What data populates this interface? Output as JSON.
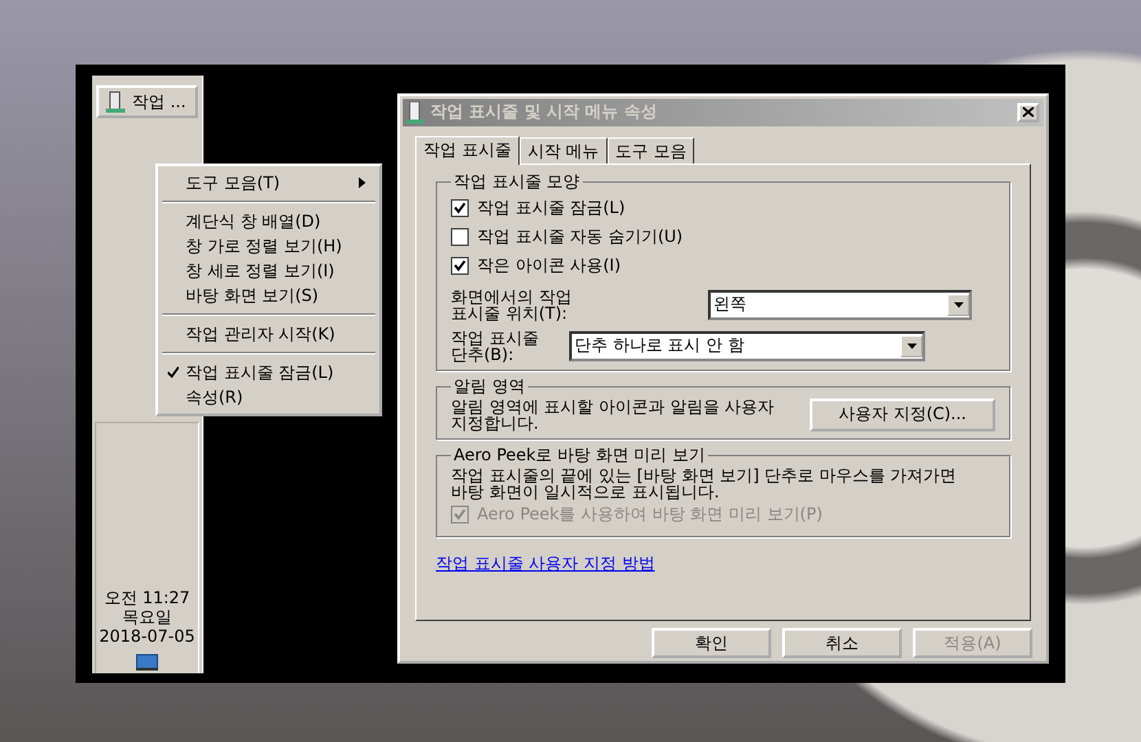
{
  "taskbar": {
    "button": "작업 ...",
    "clock": {
      "time": "오전 11:27",
      "day": "목요일",
      "date": "2018-07-05"
    }
  },
  "context_menu": {
    "groups": [
      [
        {
          "label": "도구 모음(T)",
          "checked": false,
          "submenu": true
        }
      ],
      [
        {
          "label": "계단식 창 배열(D)",
          "checked": false,
          "submenu": false
        },
        {
          "label": "창 가로 정렬 보기(H)",
          "checked": false,
          "submenu": false
        },
        {
          "label": "창 세로 정렬 보기(I)",
          "checked": false,
          "submenu": false
        },
        {
          "label": "바탕 화면 보기(S)",
          "checked": false,
          "submenu": false
        }
      ],
      [
        {
          "label": "작업 관리자 시작(K)",
          "checked": false,
          "submenu": false
        }
      ],
      [
        {
          "label": "작업 표시줄 잠금(L)",
          "checked": true,
          "submenu": false
        },
        {
          "label": "속성(R)",
          "checked": false,
          "submenu": false
        }
      ]
    ]
  },
  "dialog": {
    "title": "작업 표시줄 및 시작 메뉴 속성",
    "tabs": [
      {
        "label": "작업 표시줄",
        "selected": true
      },
      {
        "label": "시작 메뉴",
        "selected": false
      },
      {
        "label": "도구 모음",
        "selected": false
      }
    ],
    "appearance": {
      "title": "작업 표시줄 모양",
      "checkboxes": [
        {
          "label": "작업 표시줄 잠금(L)",
          "checked": true
        },
        {
          "label": "작업 표시줄 자동 숨기기(U)",
          "checked": false
        },
        {
          "label": "작은 아이콘 사용(I)",
          "checked": true
        }
      ],
      "selects": [
        {
          "label": "화면에서의 작업\n표시줄 위치(T):",
          "value": "왼쪽",
          "kind": "short"
        },
        {
          "label": "작업 표시줄\n단추(B):",
          "value": "단추 하나로 표시 안 함",
          "kind": "long"
        }
      ]
    },
    "notification": {
      "title": "알림 영역",
      "text": "알림 영역에 표시할 아이콘과 알림을 사용자\n지정합니다.",
      "button": "사용자 지정(C)..."
    },
    "peek": {
      "title": "Aero Peek로 바탕 화면 미리 보기",
      "text": "작업 표시줄의 끝에 있는 [바탕 화면 보기] 단추로 마우스를 가져가면\n바탕 화면이 일시적으로 표시됩니다.",
      "checkbox": {
        "label": "Aero Peek를 사용하여 바탕 화면 미리 보기(P)",
        "checked": true,
        "disabled": true
      }
    },
    "link": "작업 표시줄 사용자 지정 방법",
    "buttons": [
      {
        "label": "확인",
        "disabled": false
      },
      {
        "label": "취소",
        "disabled": false
      },
      {
        "label": "적용(A)",
        "disabled": true
      }
    ]
  }
}
